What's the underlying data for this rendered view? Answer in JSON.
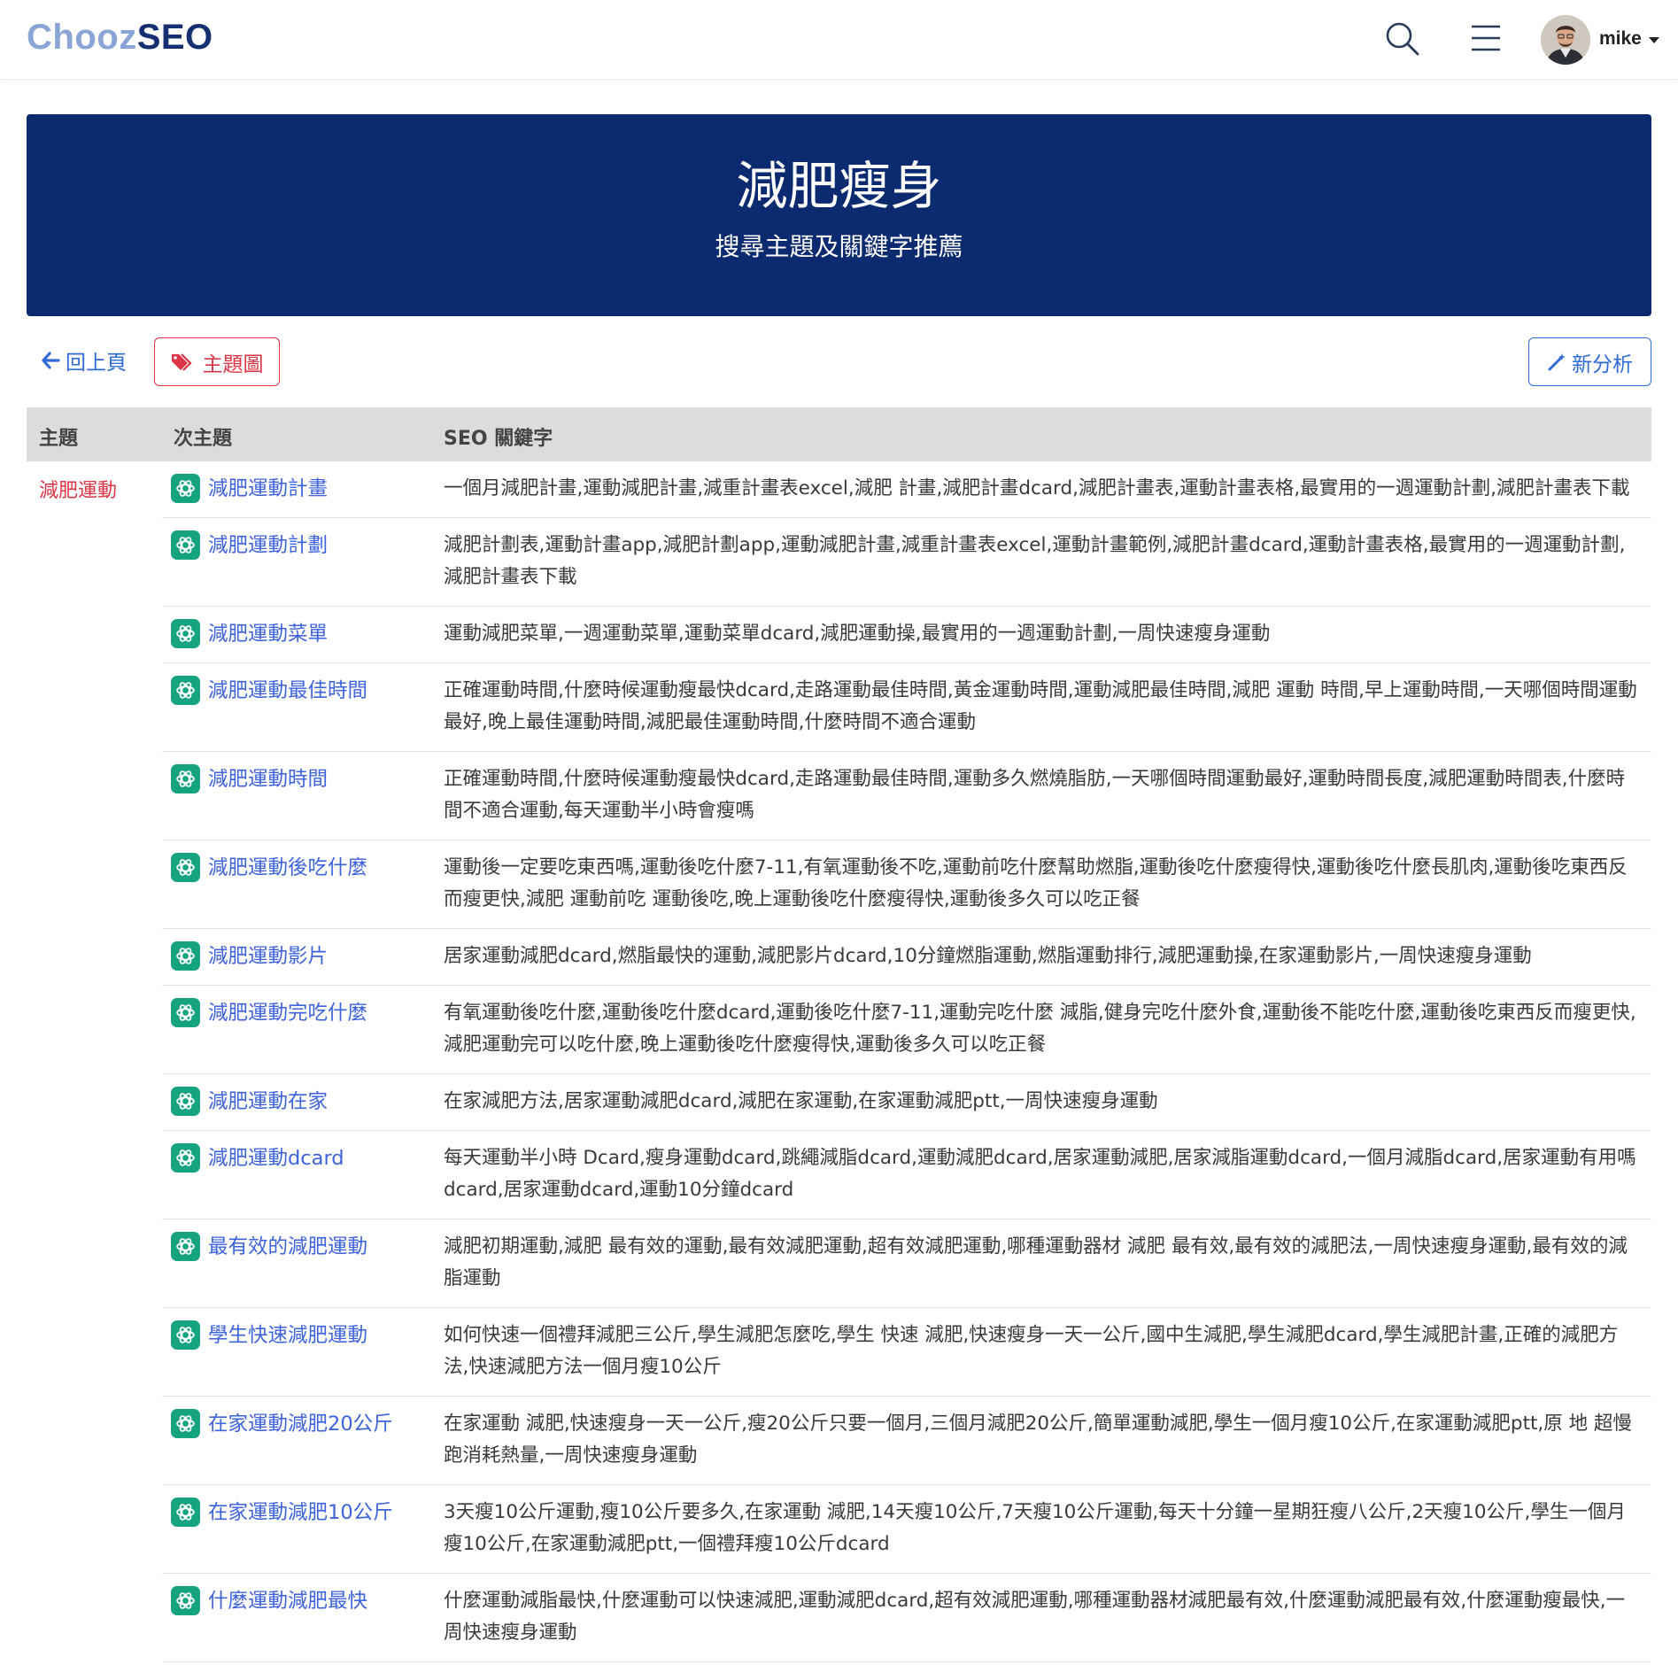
{
  "brand": {
    "part1": "Chooz",
    "part2": "SEO"
  },
  "nav": {
    "user": "mike"
  },
  "hero": {
    "title": "減肥瘦身",
    "subtitle": "搜尋主題及關鍵字推薦"
  },
  "actions": {
    "back": "回上頁",
    "topic_map": "主題圖",
    "new_analysis": "新分析"
  },
  "table": {
    "headers": [
      "主題",
      "次主題",
      "SEO 關鍵字"
    ],
    "topic": "減肥運動",
    "rows": [
      {
        "sub": "減肥運動計畫",
        "kw": "一個月減肥計畫,運動減肥計畫,減重計畫表excel,減肥 計畫,減肥計畫dcard,減肥計畫表,運動計畫表格,最實用的一週運動計劃,減肥計畫表下載"
      },
      {
        "sub": "減肥運動計劃",
        "kw": "減肥計劃表,運動計畫app,減肥計劃app,運動減肥計畫,減重計畫表excel,運動計畫範例,減肥計畫dcard,運動計畫表格,最實用的一週運動計劃,減肥計畫表下載"
      },
      {
        "sub": "減肥運動菜單",
        "kw": "運動減肥菜單,一週運動菜單,運動菜單dcard,減肥運動操,最實用的一週運動計劃,一周快速瘦身運動"
      },
      {
        "sub": "減肥運動最佳時間",
        "kw": "正確運動時間,什麼時候運動瘦最快dcard,走路運動最佳時間,黃金運動時間,運動減肥最佳時間,減肥 運動 時間,早上運動時間,一天哪個時間運動最好,晚上最佳運動時間,減肥最佳運動時間,什麼時間不適合運動"
      },
      {
        "sub": "減肥運動時間",
        "kw": "正確運動時間,什麼時候運動瘦最快dcard,走路運動最佳時間,運動多久燃燒脂肪,一天哪個時間運動最好,運動時間長度,減肥運動時間表,什麼時間不適合運動,每天運動半小時會瘦嗎"
      },
      {
        "sub": "減肥運動後吃什麼",
        "kw": "運動後一定要吃東西嗎,運動後吃什麼7-11,有氧運動後不吃,運動前吃什麼幫助燃脂,運動後吃什麼瘦得快,運動後吃什麼長肌肉,運動後吃東西反而瘦更快,減肥 運動前吃 運動後吃,晚上運動後吃什麼瘦得快,運動後多久可以吃正餐"
      },
      {
        "sub": "減肥運動影片",
        "kw": "居家運動減肥dcard,燃脂最快的運動,減肥影片dcard,10分鐘燃脂運動,燃脂運動排行,減肥運動操,在家運動影片,一周快速瘦身運動"
      },
      {
        "sub": "減肥運動完吃什麼",
        "kw": "有氧運動後吃什麼,運動後吃什麼dcard,運動後吃什麼7-11,運動完吃什麼 減脂,健身完吃什麼外食,運動後不能吃什麼,運動後吃東西反而瘦更快,減肥運動完可以吃什麼,晚上運動後吃什麼瘦得快,運動後多久可以吃正餐"
      },
      {
        "sub": "減肥運動在家",
        "kw": "在家減肥方法,居家運動減肥dcard,減肥在家運動,在家運動減肥ptt,一周快速瘦身運動"
      },
      {
        "sub": "減肥運動dcard",
        "kw": "每天運動半小時 Dcard,瘦身運動dcard,跳繩減脂dcard,運動減肥dcard,居家運動減肥,居家減脂運動dcard,一個月減脂dcard,居家運動有用嗎dcard,居家運動dcard,運動10分鐘dcard"
      },
      {
        "sub": "最有效的減肥運動",
        "kw": "減肥初期運動,減肥 最有效的運動,最有效減肥運動,超有效減肥運動,哪種運動器材 減肥 最有效,最有效的減肥法,一周快速瘦身運動,最有效的減脂運動"
      },
      {
        "sub": "學生快速減肥運動",
        "kw": "如何快速一個禮拜減肥三公斤,學生減肥怎麼吃,學生 快速 減肥,快速瘦身一天一公斤,國中生減肥,學生減肥dcard,學生減肥計畫,正確的減肥方法,快速減肥方法一個月瘦10公斤"
      },
      {
        "sub": "在家運動減肥20公斤",
        "kw": "在家運動 減肥,快速瘦身一天一公斤,瘦20公斤只要一個月,三個月減肥20公斤,簡單運動減肥,學生一個月瘦10公斤,在家運動減肥ptt,原 地 超慢跑消耗熱量,一周快速瘦身運動"
      },
      {
        "sub": "在家運動減肥10公斤",
        "kw": "3天瘦10公斤運動,瘦10公斤要多久,在家運動 減肥,14天瘦10公斤,7天瘦10公斤運動,每天十分鐘一星期狂瘦八公斤,2天瘦10公斤,學生一個月瘦10公斤,在家運動減肥ptt,一個禮拜瘦10公斤dcard"
      },
      {
        "sub": "什麼運動減肥最快",
        "kw": "什麼運動減脂最快,什麼運動可以快速減肥,運動減肥dcard,超有效減肥運動,哪種運動器材減肥最有效,什麼運動減肥最有效,什麼運動瘦最快,一周快速瘦身運動"
      }
    ]
  },
  "colors": {
    "navy": "#0b2a6f",
    "link": "#3d63dd",
    "danger": "#dc3545",
    "gpt": "#16a37f",
    "header_bg": "#dcdcdc"
  },
  "icons": [
    "search-icon",
    "menu-icon",
    "caret-down-icon",
    "arrow-left-icon",
    "tags-icon",
    "magic-wand-icon",
    "chatgpt-icon"
  ]
}
